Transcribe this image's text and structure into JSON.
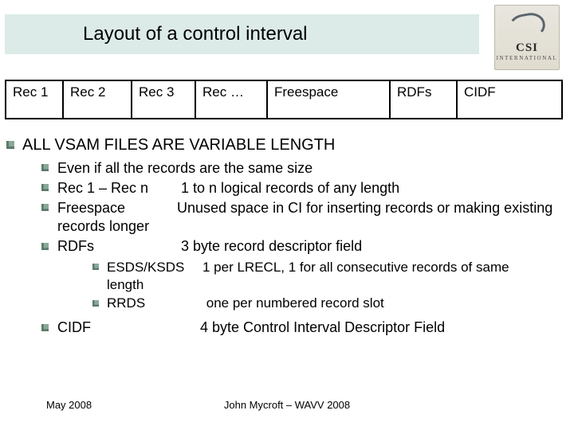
{
  "title": "Layout of a control interval",
  "logo": {
    "line1": "CSI",
    "line2": "INTERNATIONAL"
  },
  "ci_cells": [
    "Rec 1",
    "Rec 2",
    "Rec 3",
    "Rec …",
    "Freespace",
    "RDFs",
    "CIDF"
  ],
  "heading": "ALL VSAM FILES ARE VARIABLE LENGTH",
  "sub": {
    "even": "Even if all the records are the same size",
    "recs_label": "Rec 1 – Rec n",
    "recs_desc": "1 to n logical records of any length",
    "free_label": "Freespace",
    "free_desc": "Unused space in CI for inserting records or making existing records longer",
    "rdfs_label": "RDFs",
    "rdfs_desc": "3 byte record descriptor field",
    "esds_label": "ESDS/KSDS",
    "esds_desc_a": "1 per LRECL, 1 for all consecutive records of same",
    "esds_desc_b": "length",
    "rrds_label": "RRDS",
    "rrds_desc": "one per numbered record slot",
    "cidf_label": "CIDF",
    "cidf_desc": "4 byte Control Interval Descriptor Field"
  },
  "footer": {
    "left": "May 2008",
    "center": "John Mycroft – WAVV 2008"
  }
}
